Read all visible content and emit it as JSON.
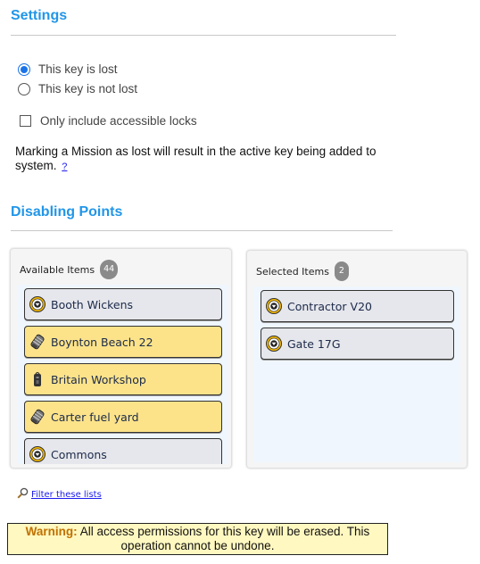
{
  "settings": {
    "title": "Settings",
    "radio_options": [
      {
        "label": "This key is lost",
        "checked": true
      },
      {
        "label": "This key is not lost",
        "checked": false
      }
    ],
    "checkbox": {
      "label": "Only include accessible locks",
      "checked": false
    },
    "note": "Marking a Mission as lost will result in the active key being added to system.",
    "help_link": "?"
  },
  "disabling_points": {
    "title": "Disabling Points",
    "available": {
      "label": "Available Items",
      "count": "44",
      "items": [
        {
          "name": "Booth Wickens",
          "icon": "cylinder-lock-icon",
          "highlight": false
        },
        {
          "name": "Boynton Beach 22",
          "icon": "padlock-cylinder-icon",
          "highlight": true
        },
        {
          "name": "Britain Workshop",
          "icon": "key-fob-icon",
          "highlight": true
        },
        {
          "name": "Carter fuel yard",
          "icon": "padlock-cylinder-icon",
          "highlight": true
        },
        {
          "name": "Commons",
          "icon": "cylinder-lock-icon",
          "highlight": false
        }
      ]
    },
    "selected": {
      "label": "Selected Items",
      "count": "2",
      "items": [
        {
          "name": "Contractor V20",
          "icon": "cylinder-lock-icon",
          "highlight": false
        },
        {
          "name": "Gate 17G",
          "icon": "cylinder-lock-icon",
          "highlight": false
        }
      ]
    },
    "filter_link": "Filter these lists"
  },
  "warning": {
    "label": "Warning:",
    "text": "All access permissions for this key will be erased. This operation cannot be undone."
  },
  "colors": {
    "heading": "#2196e8",
    "highlight_item": "#fce38a",
    "warning_bg": "#fff8c0",
    "warning_label": "#c07000"
  }
}
